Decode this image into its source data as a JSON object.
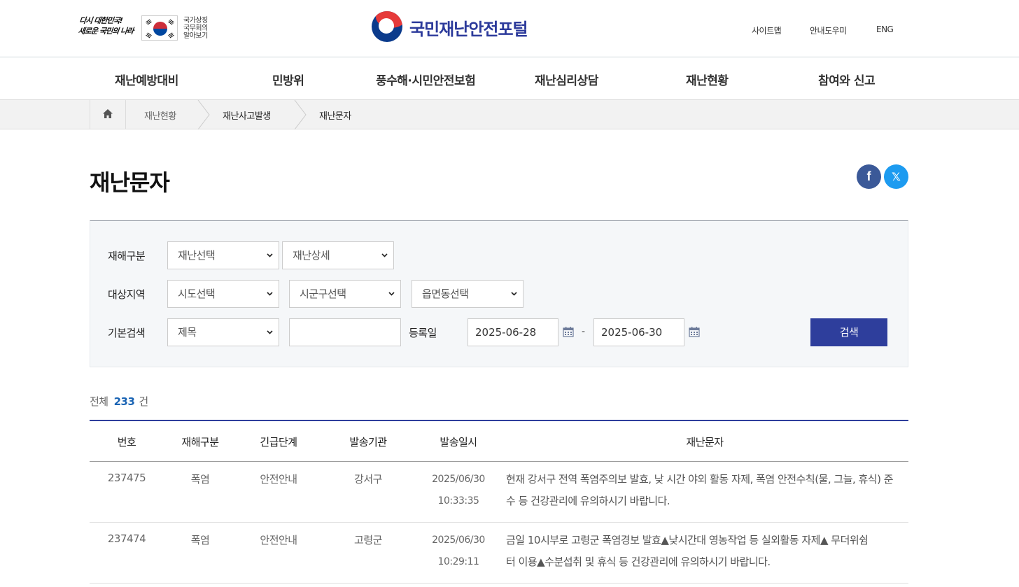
{
  "header": {
    "slogan": [
      "다시 대한민국!",
      "새로운 국민의 나라"
    ],
    "flag_text": [
      "국가상징",
      "국무회의",
      "알아보기"
    ],
    "logo_title": "국민재난안전포털",
    "util_links": [
      "사이트맵",
      "안내도우미",
      "ENG"
    ]
  },
  "gnb": [
    "재난예방대비",
    "민방위",
    "풍수해·시민안전보험",
    "재난심리상담",
    "재난현황",
    "참여와 신고"
  ],
  "breadcrumb": [
    "재난현황",
    "재난사고발생",
    "재난문자"
  ],
  "page_title": "재난문자",
  "sns": {
    "facebook": "f",
    "x": "𝕏"
  },
  "search": {
    "label_type": "재해구분",
    "sel_disaster": "재난선택",
    "sel_detail": "재난상세",
    "label_region": "대상지역",
    "sel_sido": "시도선택",
    "sel_sigungu": "시군구선택",
    "sel_eup": "읍면동선택",
    "label_basic": "기본검색",
    "sel_field": "제목",
    "keyword": "",
    "label_date": "등록일",
    "date_from": "2025-06-28",
    "date_sep": "-",
    "date_to": "2025-06-30",
    "button": "검색"
  },
  "count": {
    "prefix": "전체",
    "number": "233",
    "suffix": "건"
  },
  "table": {
    "headers": [
      "번호",
      "재해구분",
      "긴급단계",
      "발송기관",
      "발송일시",
      "재난문자"
    ],
    "rows": [
      {
        "no": "237475",
        "type": "폭염",
        "level": "안전안내",
        "agency": "강서구",
        "date": "2025/06/30",
        "time": "10:33:35",
        "msg": "현재 강서구 전역 폭염주의보 발효, 낮 시간 야외 활동 자제, 폭염 안전수칙(물, 그늘, 휴식) 준수 등 건강관리에 유의하시기 바랍니다."
      },
      {
        "no": "237474",
        "type": "폭염",
        "level": "안전안내",
        "agency": "고령군",
        "date": "2025/06/30",
        "time": "10:29:11",
        "msg": "금일 10시부로 고령군 폭염경보 발효▲낮시간대 영농작업 등 실외활동 자제▲ 무더위쉼터 이용▲수분섭취 및 휴식 등 건강관리에 유의하시기 바랍니다."
      }
    ]
  },
  "colors": {
    "brand": "#2e3e9c",
    "count_accent": "#1a64b4",
    "facebook": "#3b5998",
    "x": "#1d9bf0"
  }
}
